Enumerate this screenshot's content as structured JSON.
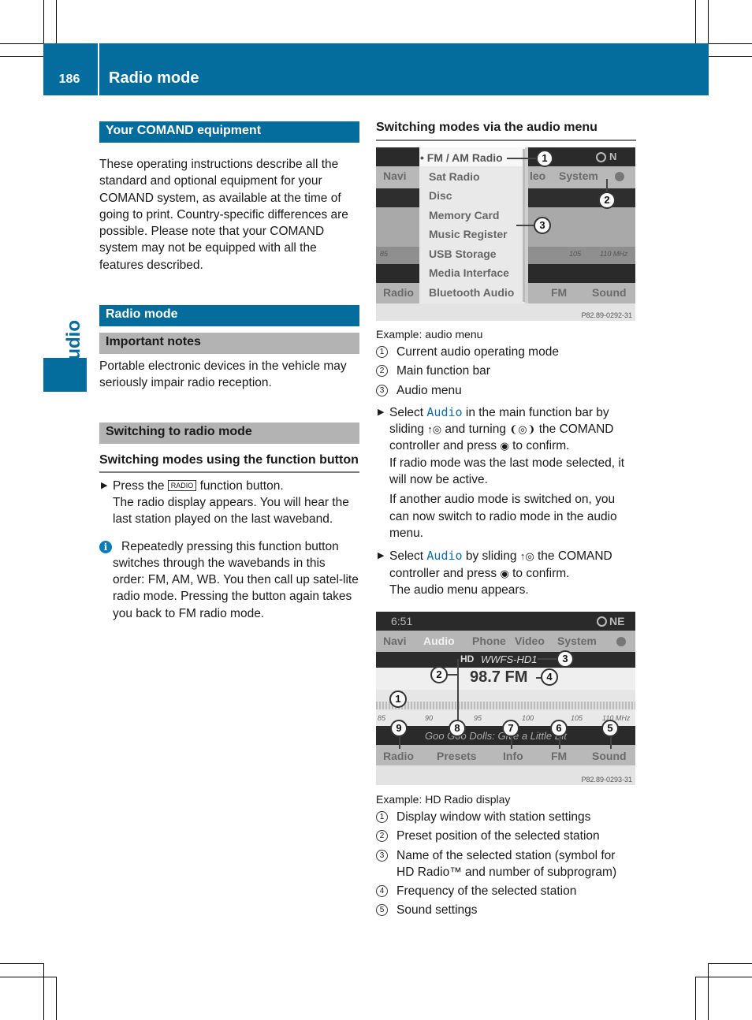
{
  "header": {
    "page_number": "186",
    "title": "Radio mode"
  },
  "side_tab": {
    "label": "Audio"
  },
  "colors": {
    "brand_blue": "#056d9e",
    "grey_heading": "#b3b3b3",
    "link_blue": "#0c6fa8"
  },
  "left": {
    "equipment_heading": "Your COMAND equipment",
    "equipment_text": "These operating instructions describe all the standard and optional equipment for your COMAND system, as available at the time of going to print. Country-specific differences are possible. Please note that your COMAND system may not be equipped with all the features described.",
    "radio_heading": "Radio mode",
    "notes_heading": "Important notes",
    "notes_text": "Portable electronic devices in the vehicle may seriously impair radio reception.",
    "switching_heading": "Switching to radio mode",
    "function_button_heading": "Switching modes using the function button",
    "step1_prefix": "Press the",
    "step1_button": "RADIO",
    "step1_suffix": "function button.",
    "step1_result": "The radio display appears. You will hear the last station played on the last waveband.",
    "info_text": "Repeatedly pressing this function button switches through the wavebands in this order: FM, AM, WB. You then call up satel-lite radio mode. Pressing the button again takes you back to FM radio mode."
  },
  "right": {
    "audio_menu_heading": "Switching modes via the audio menu",
    "fig1": {
      "menu_items": [
        "• FM / AM Radio",
        "Sat Radio",
        "Disc",
        "Memory Card",
        "Music Register",
        "USB Storage",
        "Media Interface",
        "Bluetooth Audio"
      ],
      "bg_navi": "Navi",
      "bg_video": "leo",
      "bg_system": "System",
      "bg_compass": "N",
      "bg_radio": "Radio",
      "bg_fm": "FM",
      "bg_sound": "Sound",
      "bg_freq_left": "85",
      "bg_freq_105": "105",
      "bg_freq_110": "110 MHz",
      "code": "P82.89-0292-31",
      "callouts": [
        "1",
        "2",
        "3"
      ]
    },
    "fig1_caption": "Example: audio menu",
    "fig1_legend": [
      {
        "num": "1",
        "text": "Current audio operating mode"
      },
      {
        "num": "2",
        "text": "Main function bar"
      },
      {
        "num": "3",
        "text": "Audio menu"
      }
    ],
    "step_a_prefix": "Select",
    "step_a_link": "Audio",
    "step_a_text1": "in the main function bar by sliding",
    "step_a_slide": "↑◎",
    "step_a_text2": "and turning",
    "step_a_turn": "❨◎❩",
    "step_a_text3": "the COMAND controller and press",
    "step_a_press": "◉",
    "step_a_text4": "to confirm.",
    "step_a_result1": "If radio mode was the last mode selected, it will now be active.",
    "step_a_result2": "If another audio mode is switched on, you can now switch to radio mode in the audio menu.",
    "step_b_prefix": "Select",
    "step_b_link": "Audio",
    "step_b_text1": "by sliding",
    "step_b_slide": "↑◎",
    "step_b_text2": "the COMAND controller and press",
    "step_b_press": "◉",
    "step_b_text3": "to confirm.",
    "step_b_result": "The audio menu appears.",
    "fig2": {
      "time": "6:51",
      "compass": "NE",
      "tabs": [
        "Navi",
        "Audio",
        "Phone",
        "Video",
        "System"
      ],
      "station_name": "WWFS-HD1",
      "hd_symbol": "HD",
      "frequency": "98.7 FM",
      "scale_labels": [
        "85",
        "90",
        "95",
        "100",
        "105",
        "110 MHz"
      ],
      "track": "Goo Goo Dolls: Give a Little Bit",
      "softkeys": [
        "Radio",
        "Presets",
        "Info",
        "FM",
        "Sound"
      ],
      "code": "P82.89-0293-31",
      "callouts": [
        "1",
        "2",
        "3",
        "4",
        "5",
        "6",
        "7",
        "8",
        "9"
      ]
    },
    "fig2_caption": "Example: HD Radio display",
    "fig2_legend": [
      {
        "num": "1",
        "text": "Display window with station settings"
      },
      {
        "num": "2",
        "text": "Preset position of the selected station"
      },
      {
        "num": "3",
        "text": "Name of the selected station (symbol for HD Radio™ and number of subprogram)"
      },
      {
        "num": "4",
        "text": "Frequency of the selected station"
      },
      {
        "num": "5",
        "text": "Sound settings"
      }
    ]
  }
}
